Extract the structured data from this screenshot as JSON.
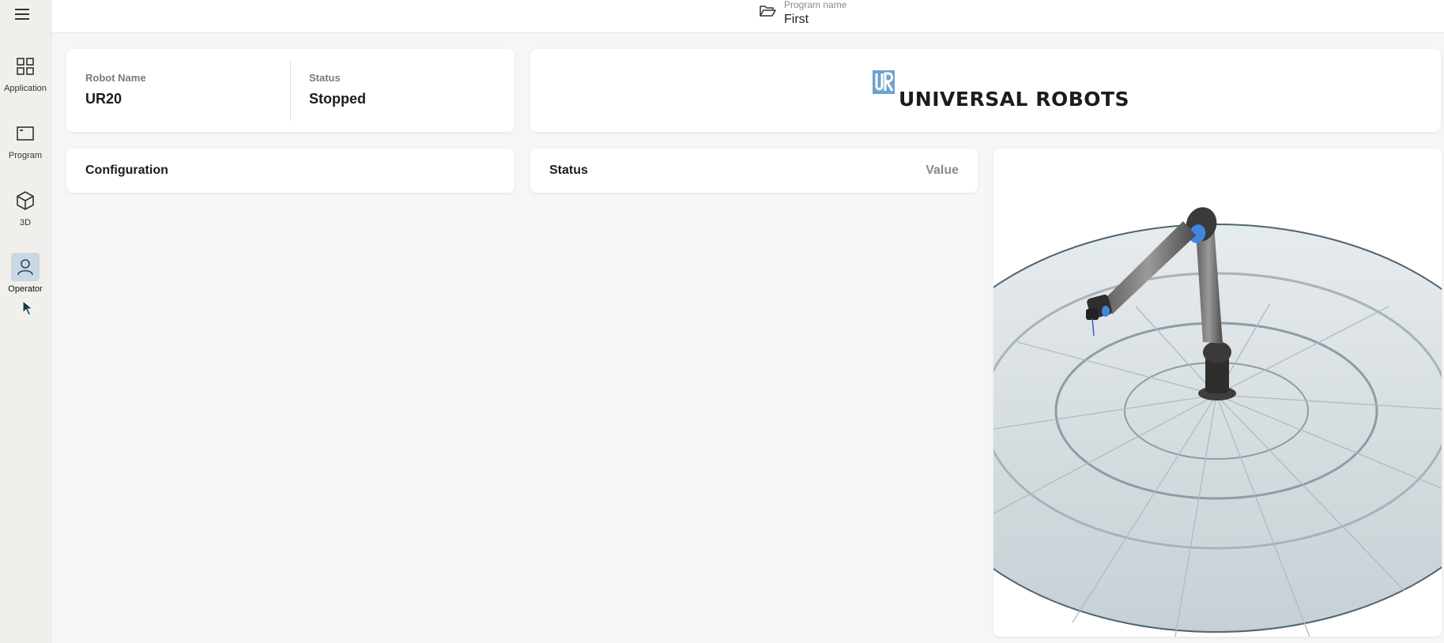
{
  "header": {
    "program_caption": "Program name",
    "program_name": "First"
  },
  "sidebar": {
    "items": [
      {
        "label": "Application",
        "icon": "grid-icon"
      },
      {
        "label": "Program",
        "icon": "program-icon"
      },
      {
        "label": "3D",
        "icon": "cube-icon"
      },
      {
        "label": "Operator",
        "icon": "user-icon",
        "active": true
      }
    ]
  },
  "robot_info": {
    "name_caption": "Robot Name",
    "name_value": "UR20",
    "status_caption": "Status",
    "status_value": "Stopped"
  },
  "logo": {
    "brand_text": "UNIVERSAL ROBOTS",
    "colors": {
      "mark": "#5b9bd5",
      "text": "#1c1c1c"
    }
  },
  "configuration": {
    "title": "Configuration"
  },
  "status_table": {
    "status_header": "Status",
    "value_header": "Value"
  },
  "viewer": {
    "accent": "#3f86e0"
  }
}
